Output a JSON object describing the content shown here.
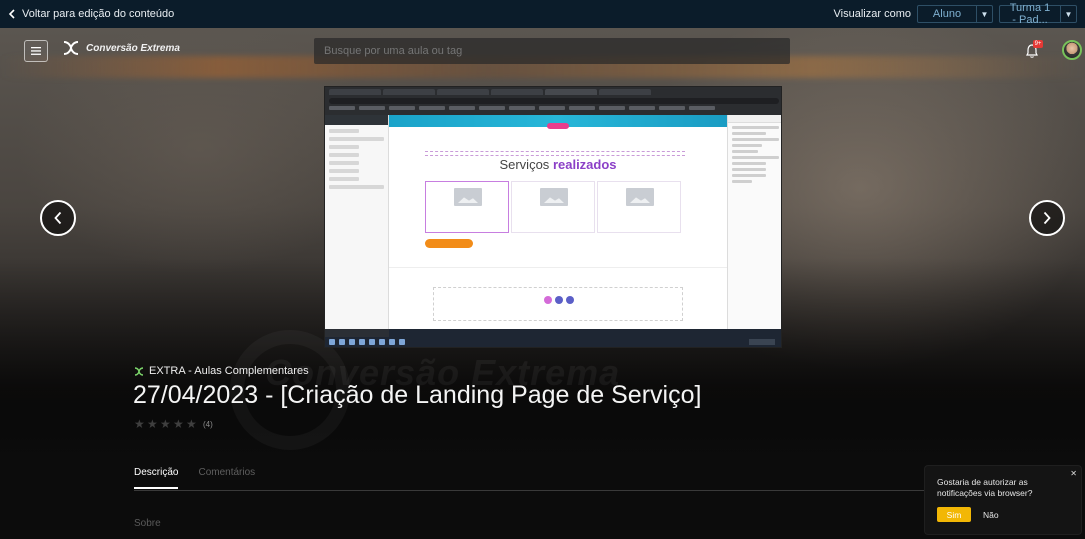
{
  "admin_bar": {
    "back_label": "Voltar para edição do conteúdo",
    "view_as_label": "Visualizar como",
    "role_value": "Aluno",
    "class_value": "Turma 1 - Pad..."
  },
  "header": {
    "brand": "Conversão Extrema",
    "search_placeholder": "Busque por uma aula ou tag",
    "notification_badge": "9+"
  },
  "video_frame": {
    "heading_plain": "Serviços",
    "heading_highlight": "realizados"
  },
  "lesson": {
    "module": "EXTRA - Aulas Complementares",
    "title": "27/04/2023 - [Criação de Landing Page de Serviço]",
    "rating_stars": 0,
    "rating_count": "(4)"
  },
  "tabs": [
    {
      "label": "Descrição",
      "active": true
    },
    {
      "label": "Comentários",
      "active": false
    }
  ],
  "about_label": "Sobre",
  "notification_prompt": {
    "message": "Gostaria de autorizar as notificações via browser?",
    "yes_label": "Sim",
    "no_label": "Não"
  },
  "colors": {
    "admin_bg": "#0b1c2a",
    "accent_yellow": "#f2b705",
    "badge_red": "#e53935",
    "avatar_ring": "#78c25a"
  },
  "icons": [
    "chevron-left-icon",
    "menu-icon",
    "logo-icon",
    "bell-icon",
    "avatar",
    "arrow-left-icon",
    "arrow-right-icon",
    "module-icon",
    "star-icon",
    "close-icon"
  ]
}
